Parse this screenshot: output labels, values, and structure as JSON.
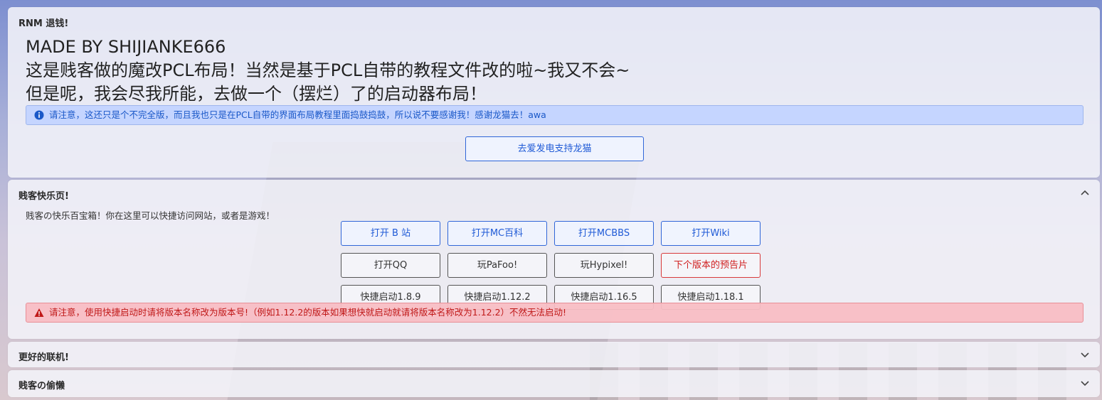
{
  "section1": {
    "title": "RNM 退钱!",
    "lines": [
      "MADE BY SHIJIANKE666",
      "这是贱客做的魔改PCL布局！当然是基于PCL自带的教程文件改的啦~我又不会~",
      "但是呢，我会尽我所能，去做一个（摆烂）了的启动器布局！"
    ],
    "notice": "请注意，这还只是个不完全版，而且我也只是在PCL自带的界面布局教程里面捣鼓捣鼓，所以说不要感谢我！感谢龙猫去！awa",
    "support_button": "去爱发电支持龙猫"
  },
  "section2": {
    "title": "贱客快乐页!",
    "description": "贱客の快乐百宝箱！你在这里可以快捷访问网站，或者是游戏！",
    "row1": [
      "打开 B 站",
      "打开MC百科",
      "打开MCBBS",
      "打开Wiki"
    ],
    "row2": [
      "打开QQ",
      "玩PaFoo!",
      "玩Hypixel!",
      "下个版本的预告片"
    ],
    "row3": [
      "快捷启动1.8.9",
      "快捷启动1.12.2",
      "快捷启动1.16.5",
      "快捷启动1.18.1"
    ],
    "warning": "请注意，使用快捷启动时请将版本名称改为版本号!（例如1.12.2的版本如果想快就启动就请将版本名称改为1.12.2）不然无法启动!"
  },
  "section3": {
    "title": "更好的联机!"
  },
  "section4": {
    "title": "贱客の偷懒"
  },
  "colors": {
    "accent_blue": "#1f5ad6",
    "danger_red": "#d02020"
  }
}
